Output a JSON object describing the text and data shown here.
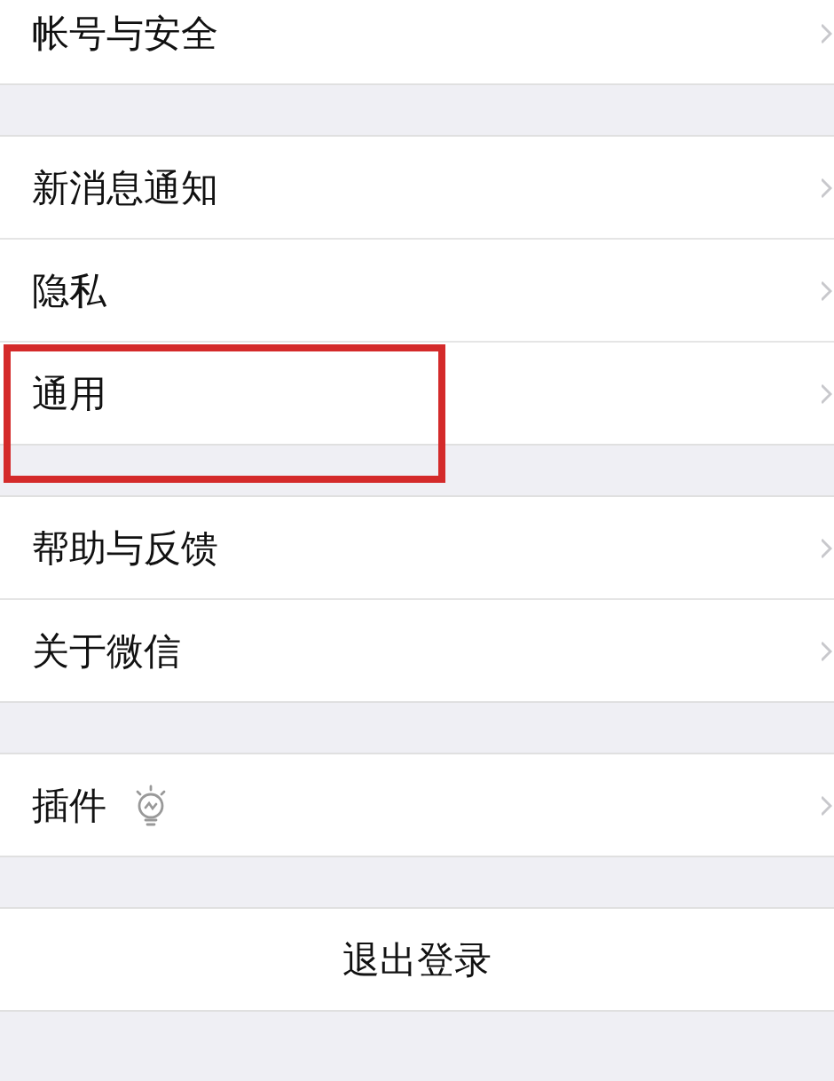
{
  "groups": [
    {
      "items": [
        {
          "label": "帐号与安全",
          "highlighted": false
        }
      ]
    },
    {
      "items": [
        {
          "label": "新消息通知",
          "highlighted": false
        },
        {
          "label": "隐私",
          "highlighted": false
        },
        {
          "label": "通用",
          "highlighted": true
        }
      ]
    },
    {
      "items": [
        {
          "label": "帮助与反馈",
          "highlighted": false
        },
        {
          "label": "关于微信",
          "highlighted": false
        }
      ]
    },
    {
      "items": [
        {
          "label": "插件",
          "highlighted": false,
          "kind": "plugin"
        }
      ]
    }
  ],
  "logout": "退出登录"
}
